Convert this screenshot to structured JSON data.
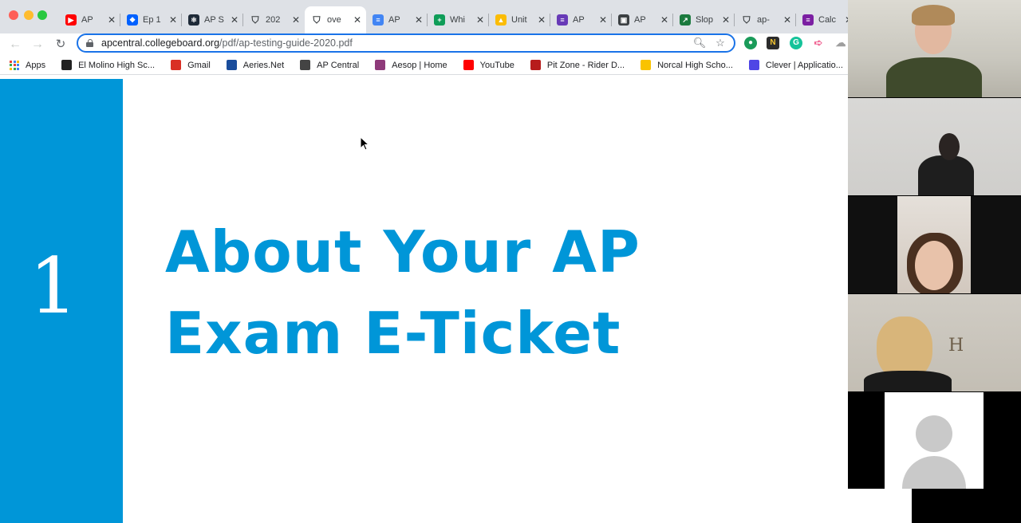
{
  "browser": {
    "tabs": [
      {
        "title": "AP",
        "favicon_color": "#ff0000",
        "favicon_glyph": "▶"
      },
      {
        "title": "Ep 1",
        "favicon_color": "#0061ff",
        "favicon_glyph": "❖"
      },
      {
        "title": "AP S",
        "favicon_color": "#1e2a38",
        "favicon_glyph": "⚛"
      },
      {
        "title": "202",
        "favicon_color": "#ffffff",
        "favicon_glyph": "⛉"
      },
      {
        "title": "ove",
        "favicon_color": "#ffffff",
        "favicon_glyph": "⛉"
      },
      {
        "title": "AP",
        "favicon_color": "#4285f4",
        "favicon_glyph": "≡"
      },
      {
        "title": "Whi",
        "favicon_color": "#0f9d58",
        "favicon_glyph": "+"
      },
      {
        "title": "Unit",
        "favicon_color": "#fbbc04",
        "favicon_glyph": "▲"
      },
      {
        "title": "AP",
        "favicon_color": "#673ab7",
        "favicon_glyph": "≡"
      },
      {
        "title": "AP",
        "favicon_color": "#3c4043",
        "favicon_glyph": "▣"
      },
      {
        "title": "Slop",
        "favicon_color": "#1b7a3e",
        "favicon_glyph": "↗"
      },
      {
        "title": "ap-",
        "favicon_color": "#ffffff",
        "favicon_glyph": "⛉"
      },
      {
        "title": "Calc",
        "favicon_color": "#7b1fa2",
        "favicon_glyph": "≡"
      }
    ],
    "active_tab_index": 4,
    "url_host": "apcentral.collegeboard.org",
    "url_path": "/pdf/ap-testing-guide-2020.pdf",
    "bookmarks": [
      {
        "label": "Apps",
        "icon": "apps-grid-icon",
        "color": "#4285f4"
      },
      {
        "label": "El Molino High Sc...",
        "icon": "shield-icon",
        "color": "#222222"
      },
      {
        "label": "Gmail",
        "icon": "gmail-icon",
        "color": "#d93025"
      },
      {
        "label": "Aeries.Net",
        "icon": "aeries-icon",
        "color": "#1a4d9c"
      },
      {
        "label": "AP Central",
        "icon": "ap-icon",
        "color": "#444444"
      },
      {
        "label": "Aesop | Home",
        "icon": "aesop-icon",
        "color": "#8e3a7a"
      },
      {
        "label": "YouTube",
        "icon": "youtube-icon",
        "color": "#ff0000"
      },
      {
        "label": "Pit Zone - Rider D...",
        "icon": "pitzone-icon",
        "color": "#b71c1c"
      },
      {
        "label": "Norcal High Scho...",
        "icon": "norcal-icon",
        "color": "#f9c300"
      },
      {
        "label": "Clever | Applicatio...",
        "icon": "clever-icon",
        "color": "#4f46e5"
      }
    ]
  },
  "slide": {
    "chapter_number": "1",
    "title_line1": "About Your AP",
    "title_line2": "Exam E-Ticket",
    "accent_color": "#0096d8"
  },
  "video_call": {
    "participant_count_visible": 5
  }
}
